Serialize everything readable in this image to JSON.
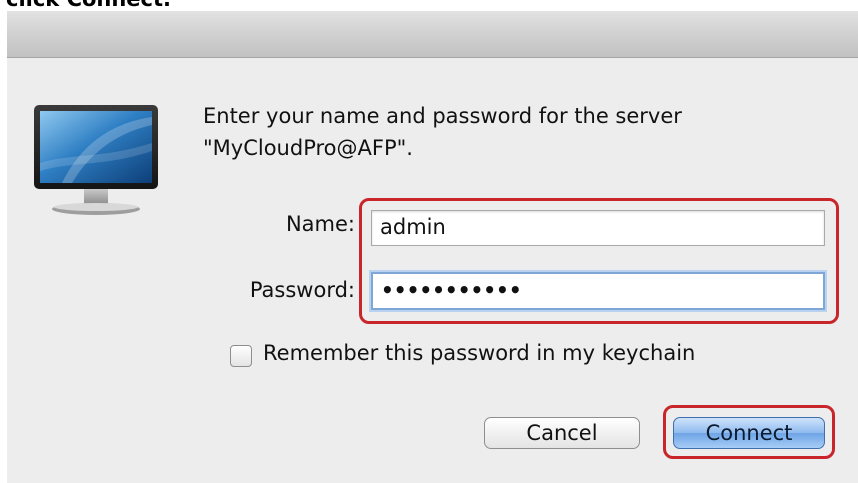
{
  "caption": "click Connect.",
  "dialog": {
    "message_line1": "Enter your name and password for the server",
    "message_line2": "\"MyCloudPro@AFP\".",
    "icon": "monitor-icon"
  },
  "form": {
    "name_label": "Name:",
    "name_value": "admin",
    "password_label": "Password:",
    "password_value": "•••••••••••",
    "remember_label": "Remember this password in my keychain",
    "remember_checked": false
  },
  "buttons": {
    "cancel_label": "Cancel",
    "connect_label": "Connect"
  },
  "colors": {
    "highlight": "#c8262b",
    "focus_ring": "#7ea6d6",
    "default_button": "#6ea4e6"
  }
}
